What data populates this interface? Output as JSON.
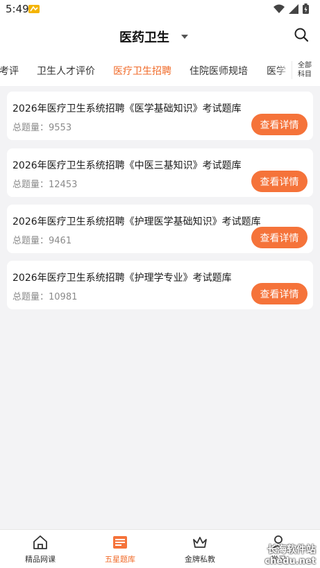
{
  "status": {
    "time": "5:49"
  },
  "header": {
    "title": "医药卫生"
  },
  "tabs": [
    {
      "label": "考评",
      "active": false
    },
    {
      "label": "卫生人才评价",
      "active": false
    },
    {
      "label": "医疗卫生招聘",
      "active": true
    },
    {
      "label": "住院医师规培",
      "active": false
    },
    {
      "label": "医学",
      "active": false
    }
  ],
  "all_subjects": {
    "line1": "全部",
    "line2": "科目"
  },
  "cards": [
    {
      "title": "2026年医疗卫生系统招聘《医学基础知识》考试题库",
      "count_label": "总题量：",
      "count": "9553",
      "button": "查看详情"
    },
    {
      "title": "2026年医疗卫生系统招聘《中医三基知识》考试题库",
      "count_label": "总题量：",
      "count": "12453",
      "button": "查看详情"
    },
    {
      "title": "2026年医疗卫生系统招聘《护理医学基础知识》考试题库",
      "count_label": "总题量：",
      "count": "9461",
      "button": "查看详情"
    },
    {
      "title": "2026年医疗卫生系统招聘《护理学专业》考试题库",
      "count_label": "总题量：",
      "count": "10981",
      "button": "查看详情"
    }
  ],
  "bottom_nav": [
    {
      "label": "精品网课",
      "icon": "home-icon"
    },
    {
      "label": "五星题库",
      "icon": "question-bank-icon",
      "active": true
    },
    {
      "label": "金牌私教",
      "icon": "crown-icon"
    },
    {
      "label": "学习",
      "icon": "user-icon"
    }
  ],
  "watermark": {
    "line1": "长海软件站",
    "line2": "chedu.net"
  },
  "colors": {
    "accent": "#f5733a",
    "active_text": "#f06a28",
    "background": "#f3f3f5"
  }
}
